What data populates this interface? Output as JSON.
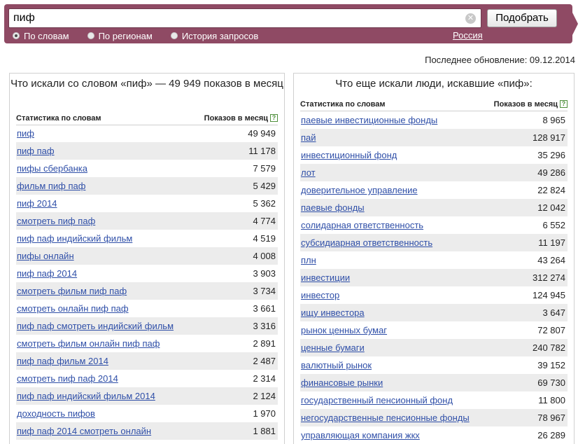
{
  "search": {
    "query": "пиф",
    "clear_icon": "clear-icon",
    "submit_label": "Подобрать"
  },
  "tabs": [
    {
      "label": "По словам",
      "selected": true
    },
    {
      "label": "По регионам",
      "selected": false
    },
    {
      "label": "История запросов",
      "selected": false
    }
  ],
  "region": "Россия",
  "update_text": "Последнее обновление: 09.12.2014",
  "left": {
    "title": "Что искали со словом «пиф» — 49 949 показов в месяц",
    "col_phrase": "Статистика по словам",
    "col_count": "Показов в месяц",
    "help_glyph": "?",
    "rows": [
      {
        "phrase": "пиф",
        "count": "49 949"
      },
      {
        "phrase": "пиф паф",
        "count": "11 178"
      },
      {
        "phrase": "пифы сбербанка",
        "count": "7 579"
      },
      {
        "phrase": "фильм пиф паф",
        "count": "5 429"
      },
      {
        "phrase": "пиф 2014",
        "count": "5 362"
      },
      {
        "phrase": "смотреть пиф паф",
        "count": "4 774"
      },
      {
        "phrase": "пиф паф индийский фильм",
        "count": "4 519"
      },
      {
        "phrase": "пифы онлайн",
        "count": "4 008"
      },
      {
        "phrase": "пиф паф 2014",
        "count": "3 903"
      },
      {
        "phrase": "смотреть фильм пиф паф",
        "count": "3 734"
      },
      {
        "phrase": "смотреть онлайн пиф паф",
        "count": "3 661"
      },
      {
        "phrase": "пиф паф смотреть индийский фильм",
        "count": "3 316"
      },
      {
        "phrase": "смотреть фильм онлайн пиф паф",
        "count": "2 891"
      },
      {
        "phrase": "пиф паф фильм 2014",
        "count": "2 487"
      },
      {
        "phrase": "смотреть пиф паф 2014",
        "count": "2 314"
      },
      {
        "phrase": "пиф паф индийский фильм 2014",
        "count": "2 124"
      },
      {
        "phrase": "доходность пифов",
        "count": "1 970"
      },
      {
        "phrase": "пиф паф 2014 смотреть онлайн",
        "count": "1 881"
      }
    ]
  },
  "right": {
    "title": "Что еще искали люди, искавшие «пиф»:",
    "col_phrase": "Статистика по словам",
    "col_count": "Показов в месяц",
    "help_glyph": "?",
    "rows": [
      {
        "phrase": "паевые инвестиционные фонды",
        "count": "8 965"
      },
      {
        "phrase": "пай",
        "count": "128 917"
      },
      {
        "phrase": "инвестиционный фонд",
        "count": "35 296"
      },
      {
        "phrase": "лот",
        "count": "49 286"
      },
      {
        "phrase": "доверительное управление",
        "count": "22 824"
      },
      {
        "phrase": "паевые фонды",
        "count": "12 042"
      },
      {
        "phrase": "солидарная ответственность",
        "count": "6 552"
      },
      {
        "phrase": "субсидиарная ответственность",
        "count": "11 197"
      },
      {
        "phrase": "плн",
        "count": "43 264"
      },
      {
        "phrase": "инвестиции",
        "count": "312 274"
      },
      {
        "phrase": "инвестор",
        "count": "124 945"
      },
      {
        "phrase": "ищу инвестора",
        "count": "3 647"
      },
      {
        "phrase": "рынок ценных бумаг",
        "count": "72 807"
      },
      {
        "phrase": "ценные бумаги",
        "count": "240 782"
      },
      {
        "phrase": "валютный рынок",
        "count": "39 152"
      },
      {
        "phrase": "финансовые рынки",
        "count": "69 730"
      },
      {
        "phrase": "государственный пенсионный фонд",
        "count": "11 800"
      },
      {
        "phrase": "негосударственные пенсионные фонды",
        "count": "78 967"
      },
      {
        "phrase": "управляющая компания жкх",
        "count": "26 289"
      }
    ]
  }
}
